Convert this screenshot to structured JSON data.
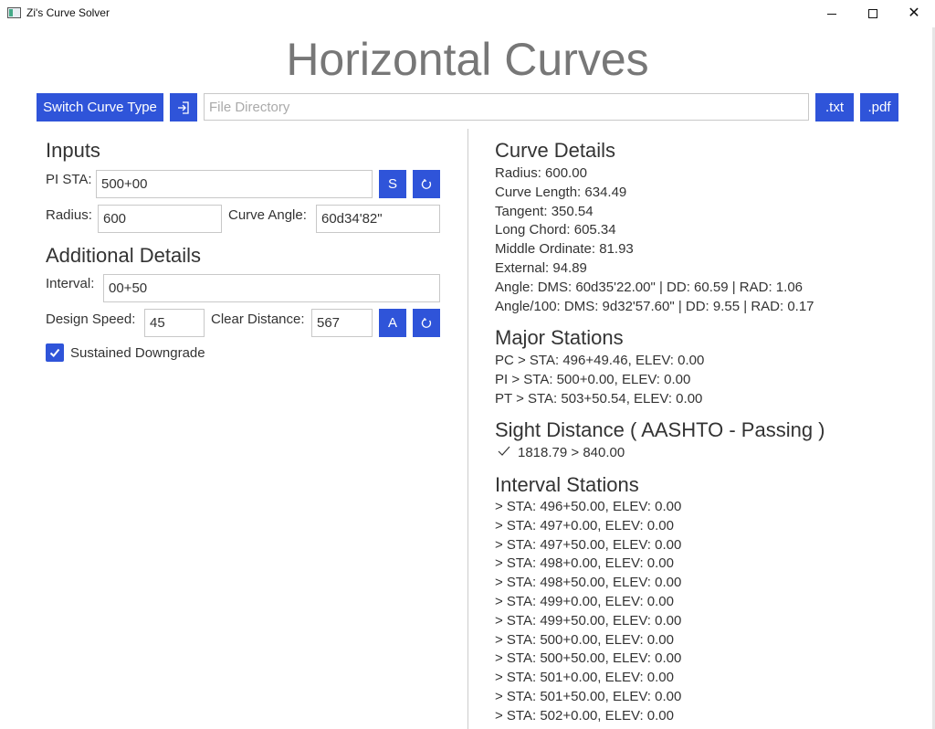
{
  "window": {
    "title": "Zi's Curve Solver",
    "controls": {
      "minimize": "minimize-icon",
      "maximize": "maximize-icon",
      "close": "close-icon"
    }
  },
  "header": {
    "title": "Horizontal Curves",
    "switch_label": "Switch Curve Type",
    "file_placeholder": "File Directory",
    "txt_label": ".txt",
    "pdf_label": ".pdf"
  },
  "inputs": {
    "heading": "Inputs",
    "pi_sta_label": "PI STA:",
    "pi_sta_value": "500+00",
    "s_button": "S",
    "radius_label": "Radius:",
    "radius_value": "600",
    "curve_angle_label": "Curve Angle:",
    "curve_angle_value": "60d34'82\""
  },
  "additional": {
    "heading": "Additional Details",
    "interval_label": "Interval:",
    "interval_value": "00+50",
    "design_speed_label": "Design Speed:",
    "design_speed_value": "45",
    "clear_distance_label": "Clear Distance:",
    "clear_distance_value": "567",
    "a_button": "A",
    "sustained_label": "Sustained Downgrade",
    "sustained_checked": true
  },
  "curve_details": {
    "heading": "Curve Details",
    "lines": [
      "Radius: 600.00",
      "Curve Length: 634.49",
      "Tangent: 350.54",
      "Long Chord: 605.34",
      "Middle Ordinate: 81.93",
      "External: 94.89",
      "Angle: DMS: 60d35'22.00\" | DD: 60.59 | RAD: 1.06",
      "Angle/100: DMS: 9d32'57.60\" | DD: 9.55 | RAD: 0.17"
    ]
  },
  "major_stations": {
    "heading": "Major Stations",
    "lines": [
      "PC > STA: 496+49.46, ELEV: 0.00",
      "PI > STA: 500+0.00, ELEV: 0.00",
      "PT > STA: 503+50.54, ELEV: 0.00"
    ]
  },
  "sight_distance": {
    "heading": "Sight Distance ( AASHTO - Passing )",
    "result": "1818.79 > 840.00"
  },
  "interval_stations": {
    "heading": "Interval Stations",
    "lines": [
      "> STA: 496+50.00, ELEV: 0.00",
      "> STA: 497+0.00, ELEV: 0.00",
      "> STA: 497+50.00, ELEV: 0.00",
      "> STA: 498+0.00, ELEV: 0.00",
      "> STA: 498+50.00, ELEV: 0.00",
      "> STA: 499+0.00, ELEV: 0.00",
      "> STA: 499+50.00, ELEV: 0.00",
      "> STA: 500+0.00, ELEV: 0.00",
      "> STA: 500+50.00, ELEV: 0.00",
      "> STA: 501+0.00, ELEV: 0.00",
      "> STA: 501+50.00, ELEV: 0.00",
      "> STA: 502+0.00, ELEV: 0.00"
    ]
  },
  "colors": {
    "accent": "#2f54d9",
    "title": "#777777"
  }
}
